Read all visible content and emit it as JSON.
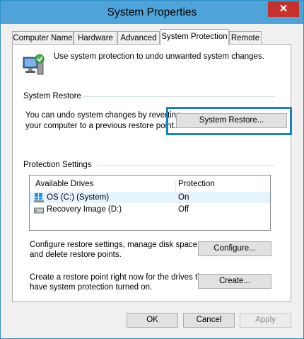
{
  "window": {
    "title": "System Properties",
    "close_symbol": "✕"
  },
  "tabs": [
    {
      "label": "Computer Name",
      "active": false
    },
    {
      "label": "Hardware",
      "active": false
    },
    {
      "label": "Advanced",
      "active": false
    },
    {
      "label": "System Protection",
      "active": true
    },
    {
      "label": "Remote",
      "active": false
    }
  ],
  "intro": {
    "text": "Use system protection to undo unwanted system changes.",
    "icon": "computer-shield-icon"
  },
  "system_restore": {
    "heading": "System Restore",
    "line1": "You can undo system changes by reverting",
    "line2": "your computer to a previous restore point.",
    "button": "System Restore..."
  },
  "protection": {
    "heading": "Protection Settings",
    "col_drives": "Available Drives",
    "col_protection": "Protection",
    "drives": [
      {
        "name": "OS (C:) (System)",
        "status": "On",
        "icon": "windows-drive-icon"
      },
      {
        "name": "Recovery Image (D:)",
        "status": "Off",
        "icon": "drive-icon"
      }
    ],
    "configure_line1": "Configure restore settings, manage disk space,",
    "configure_line2": "and delete restore points.",
    "configure_button": "Configure...",
    "create_line1": "Create a restore point right now for the drives that",
    "create_line2": "have system protection turned on.",
    "create_button": "Create..."
  },
  "footer": {
    "ok": "OK",
    "cancel": "Cancel",
    "apply": "Apply"
  },
  "colors": {
    "titlebar": "#4ea3d8",
    "close": "#c7312b",
    "highlight": "#1b85c2"
  }
}
